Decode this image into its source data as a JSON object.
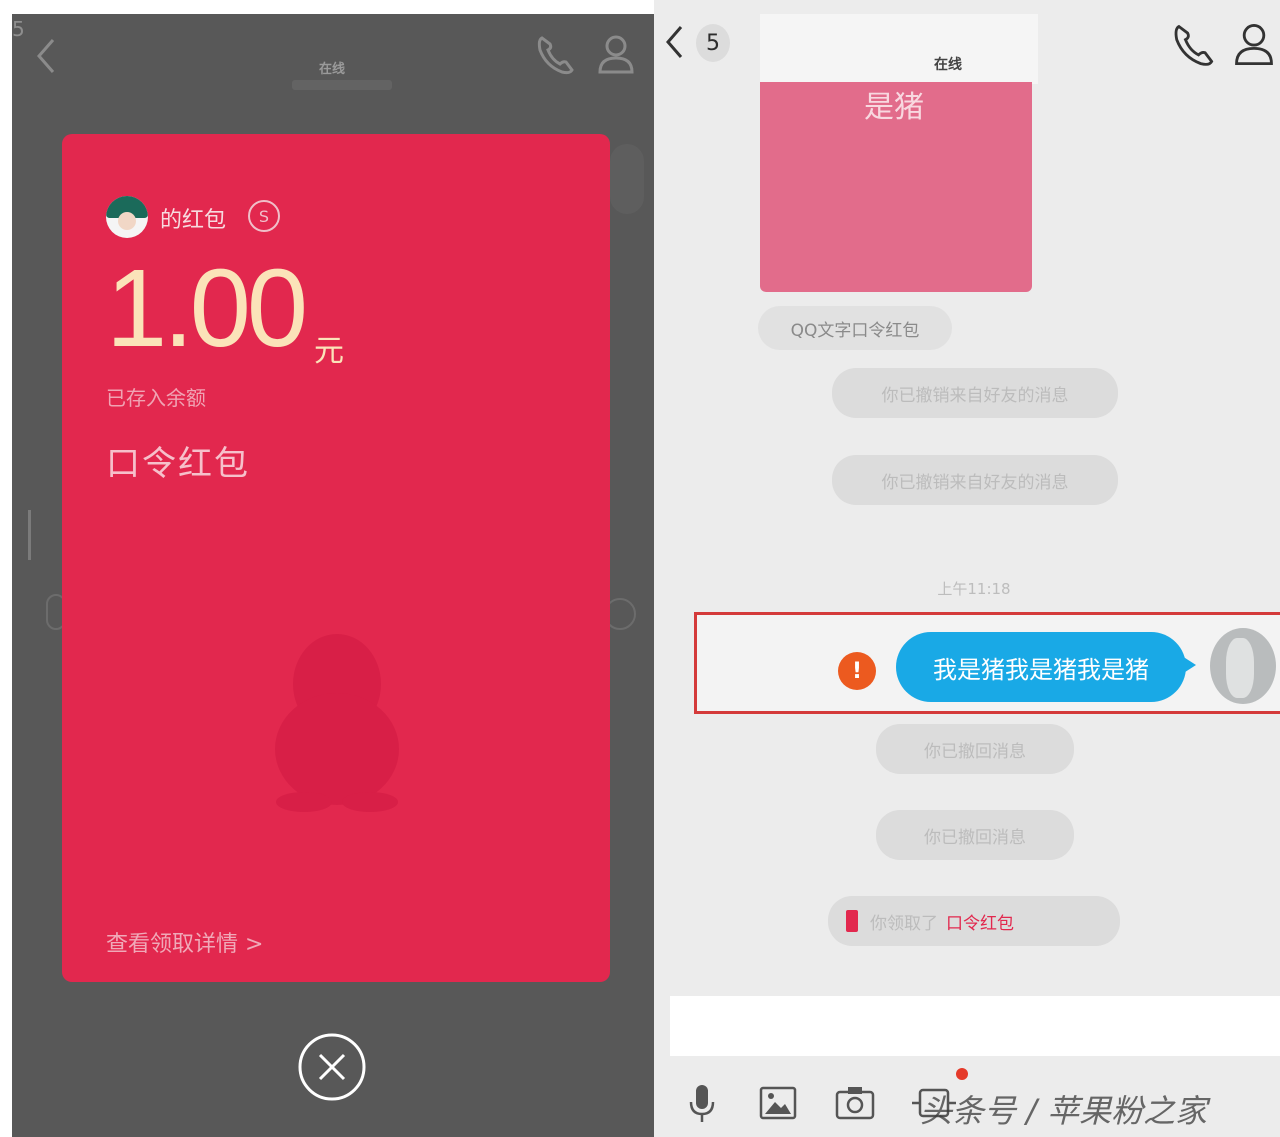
{
  "left": {
    "unread_count": "5",
    "chat_title": "在线",
    "card": {
      "sender_label": "的红包",
      "amount": "1.00",
      "unit": "元",
      "status": "已存入余额",
      "type": "口令红包",
      "details_link": "查看领取详情 >"
    }
  },
  "right": {
    "unread_count": "5",
    "chat_title": "在线",
    "pink_image_text": "是猪",
    "label_pill": "QQ文字口令红包",
    "system_msg_1": "你已撤销来自好友的消息",
    "system_msg_2": "你已撤销来自好友的消息",
    "time": "上午11:18",
    "sent_message": "我是猪我是猪我是猪",
    "system_msg_3": "你已撤回消息",
    "system_msg_4": "你已撤回消息",
    "redpacket_notice_prefix": "你领取了",
    "redpacket_notice_link": "口令红包",
    "watermark": "头条号 / 苹果粉之家"
  },
  "colors": {
    "card_red": "#e2284e",
    "bubble_blue": "#19a9e6",
    "error_orange": "#ec5a1f",
    "highlight_border": "#d43a3a"
  }
}
